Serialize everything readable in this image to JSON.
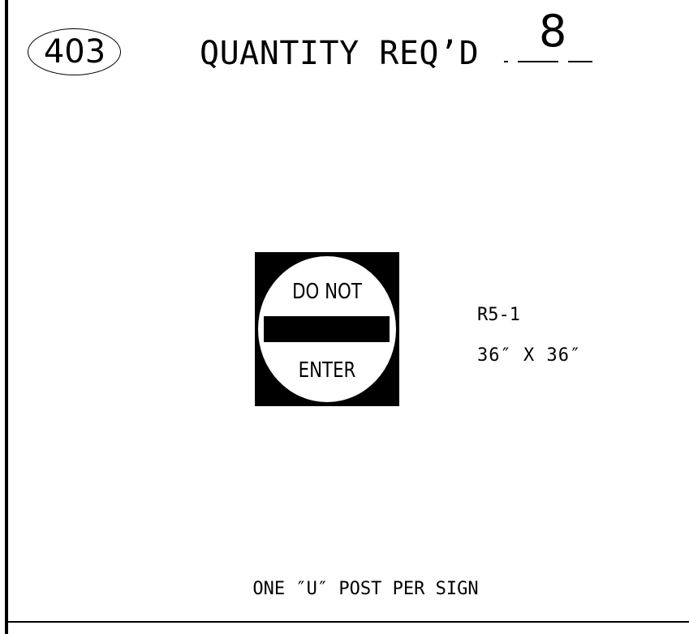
{
  "header": {
    "sign_number": "403",
    "quantity_label": "QUANTITY REQ’D",
    "quantity_value": "8"
  },
  "sign": {
    "top_text": "DO NOT",
    "bottom_text": "ENTER",
    "code": "R5-1",
    "size": "36″ X 36″",
    "colors": {
      "background": "#000000",
      "face": "#ffffff",
      "bar": "#000000"
    }
  },
  "footer": {
    "note": "ONE ″U″ POST PER SIGN"
  }
}
